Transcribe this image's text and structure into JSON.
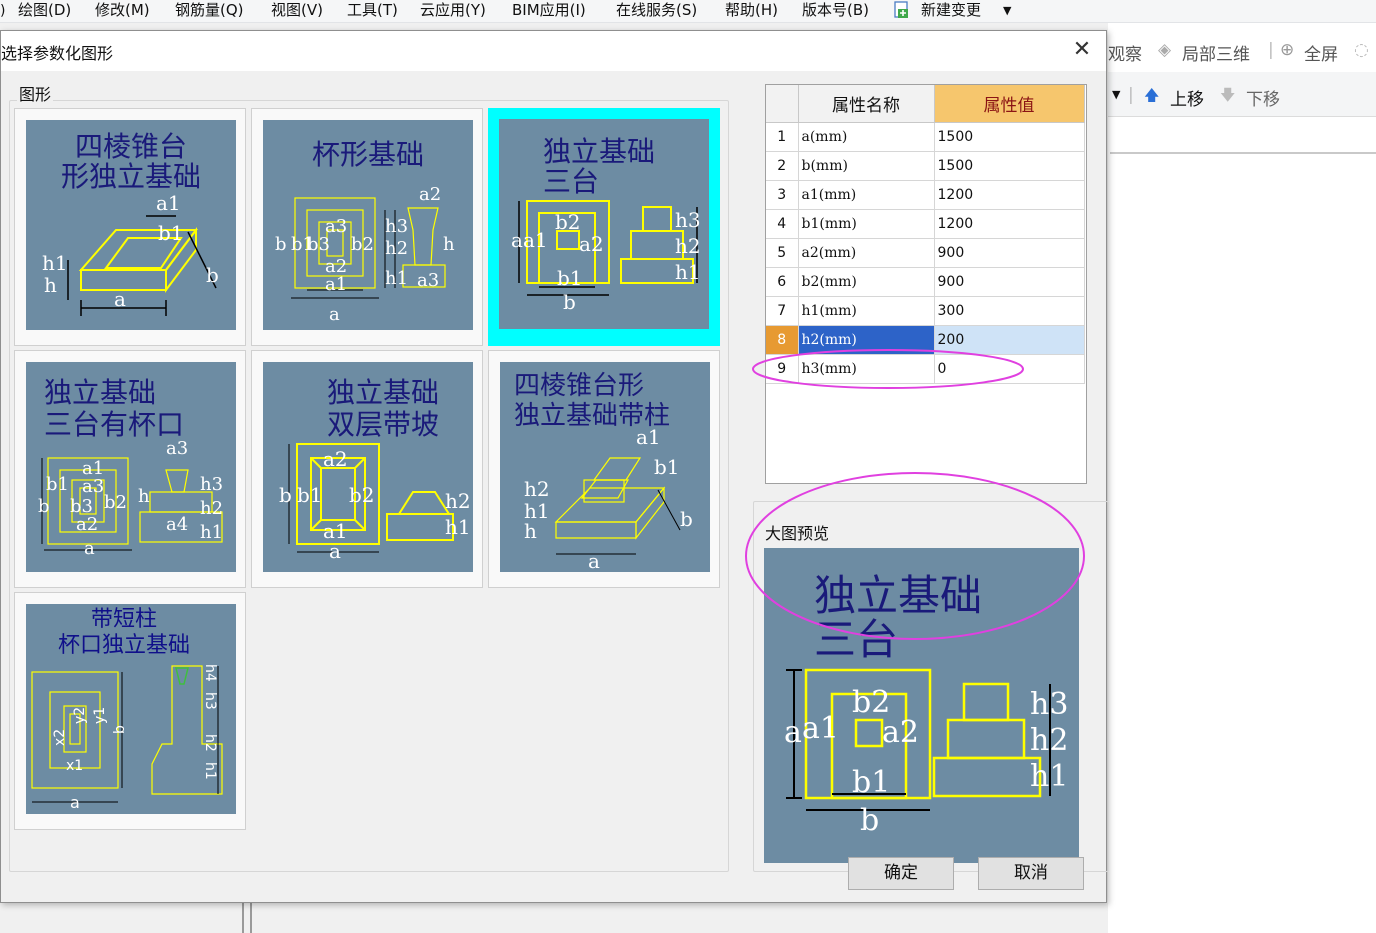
{
  "menubar": {
    "partial_left": ")",
    "items": [
      "绘图(D)",
      "修改(M)",
      "钢筋量(Q)",
      "视图(V)",
      "工具(T)",
      "云应用(Y)",
      "BIM应用(I)",
      "在线服务(S)",
      "帮助(H)",
      "版本号(B)",
      "新建变更"
    ]
  },
  "toolbar": {
    "observe": "观察",
    "local3d": "局部三维",
    "fullscreen": "全屏",
    "move_up": "上移",
    "move_down": "下移"
  },
  "dialog": {
    "title": "选择参数化图形",
    "group_label": "图形",
    "preview_label": "大图预览",
    "ok": "确定",
    "cancel": "取消"
  },
  "shapes": [
    {
      "title_lines": [
        "四棱锥台",
        "形独立基础"
      ],
      "labels": [
        "a1",
        "b1",
        "h1",
        "h",
        "a",
        "b"
      ],
      "selected": false
    },
    {
      "title_lines": [
        "杯形基础"
      ],
      "labels": [
        "a2",
        "a3",
        "b",
        "b1",
        "b3",
        "b2",
        "h3",
        "h2",
        "h1",
        "h",
        "a2",
        "a1",
        "a",
        "a3"
      ],
      "selected": false
    },
    {
      "title_lines": [
        "独立基础",
        "三台"
      ],
      "labels": [
        "b2",
        "a",
        "a1",
        "a2",
        "b1",
        "b",
        "h3",
        "h2",
        "h1"
      ],
      "selected": true
    },
    {
      "title_lines": [
        "独立基础",
        "三台有杯口"
      ],
      "labels": [
        "a3",
        "a1",
        "b1",
        "a3",
        "b",
        "b3",
        "b2",
        "a2",
        "a",
        "h",
        "a4",
        "h3",
        "h2",
        "h1"
      ],
      "selected": false
    },
    {
      "title_lines": [
        "独立基础",
        "双层带坡"
      ],
      "labels": [
        "a2",
        "b",
        "b1",
        "b2",
        "a1",
        "a",
        "h2",
        "h1"
      ],
      "selected": false
    },
    {
      "title_lines": [
        "四棱锥台形",
        "独立基础带柱"
      ],
      "labels": [
        "a1",
        "b1",
        "h2",
        "h1",
        "h",
        "a",
        "b"
      ],
      "selected": false
    },
    {
      "title_lines": [
        "带短柱",
        "杯口独立基础"
      ],
      "labels": [
        "x2",
        "y2",
        "y1",
        "b",
        "x1",
        "a",
        "h4",
        "h3",
        "h2",
        "h1"
      ],
      "selected": false
    }
  ],
  "properties": {
    "headers": [
      "属性名称",
      "属性值"
    ],
    "rows": [
      {
        "index": "1",
        "name": "a(mm)",
        "value": "1500"
      },
      {
        "index": "2",
        "name": "b(mm)",
        "value": "1500"
      },
      {
        "index": "3",
        "name": "a1(mm)",
        "value": "1200"
      },
      {
        "index": "4",
        "name": "b1(mm)",
        "value": "1200"
      },
      {
        "index": "5",
        "name": "a2(mm)",
        "value": "900"
      },
      {
        "index": "6",
        "name": "b2(mm)",
        "value": "900"
      },
      {
        "index": "7",
        "name": "h1(mm)",
        "value": "300"
      },
      {
        "index": "8",
        "name": "h2(mm)",
        "value": "200"
      },
      {
        "index": "9",
        "name": "h3(mm)",
        "value": "0"
      }
    ],
    "current_row": 8
  },
  "preview": {
    "title_lines": [
      "独立基础",
      "三台"
    ],
    "labels": [
      "b2",
      "a",
      "a1",
      "a2",
      "b1",
      "b",
      "h3",
      "h2",
      "h1"
    ]
  },
  "colors": {
    "thumb_bg": "#6d8ca3",
    "selected_border": "#00ffff",
    "drawing_line": "#ffff00",
    "title_text": "#1a1a7a",
    "annotation": "#e040e0",
    "value_header": "#f6c66d",
    "current_name_bg": "#2d63c8"
  }
}
